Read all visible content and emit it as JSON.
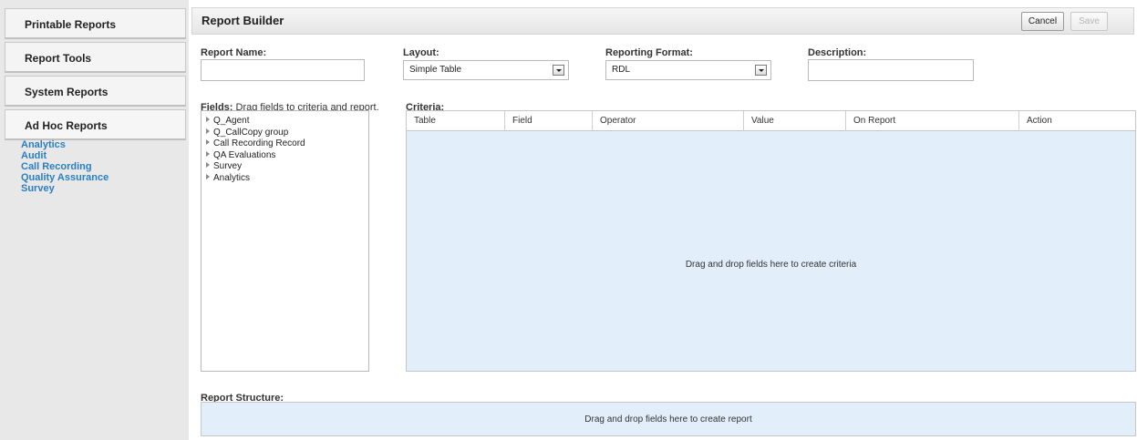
{
  "sidebar": {
    "tabs": [
      {
        "label": "Printable Reports"
      },
      {
        "label": "Report Tools"
      },
      {
        "label": "System Reports"
      },
      {
        "label": "Ad Hoc Reports"
      }
    ],
    "adhoc_items": [
      "Analytics",
      "Audit",
      "Call Recording",
      "Quality Assurance",
      "Survey"
    ]
  },
  "header": {
    "title": "Report Builder",
    "cancel_label": "Cancel",
    "save_label": "Save"
  },
  "form": {
    "report_name_label": "Report Name:",
    "report_name_value": "",
    "layout_label": "Layout:",
    "layout_value": "Simple Table",
    "format_label": "Reporting Format:",
    "format_value": "RDL",
    "description_label": "Description:",
    "description_value": ""
  },
  "fields": {
    "label": "Fields:",
    "hint": "Drag fields to criteria and report.",
    "items": [
      "Q_Agent",
      "Q_CallCopy group",
      "Call Recording Record",
      "QA Evaluations",
      "Survey",
      "Analytics"
    ]
  },
  "criteria": {
    "label": "Criteria:",
    "columns": [
      "Table",
      "Field",
      "Operator",
      "Value",
      "On Report",
      "Action"
    ],
    "empty_message": "Drag and drop fields here to create criteria"
  },
  "structure": {
    "label": "Report Structure:",
    "empty_message": "Drag and drop fields here to create report"
  },
  "colors": {
    "accent_link": "#2a7fc0",
    "drop_zone": "#e2eefa"
  }
}
